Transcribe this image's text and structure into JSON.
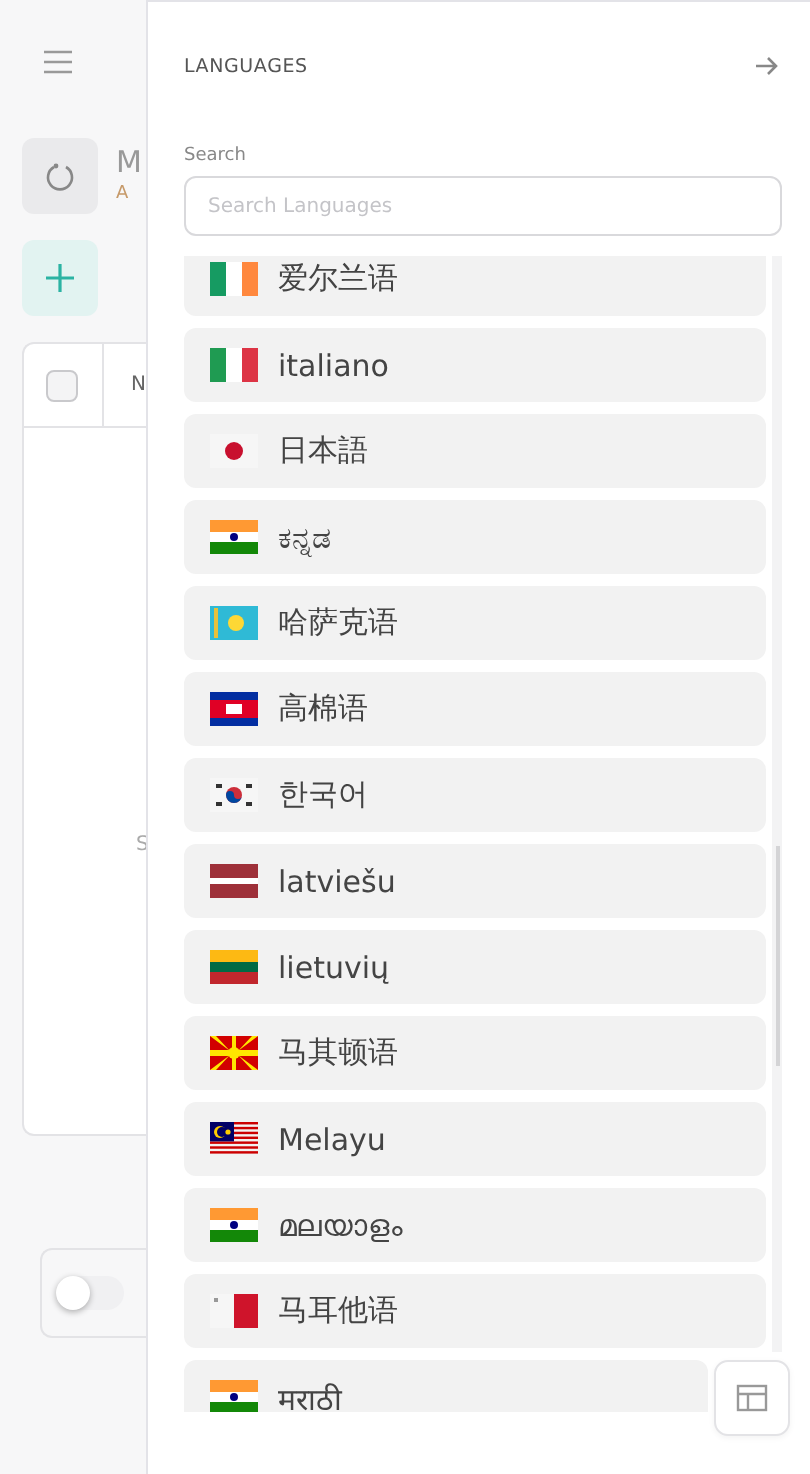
{
  "background": {
    "profile_initial": "M",
    "profile_sub": "A",
    "select_all": {
      "checked": false
    },
    "table_header": "N",
    "table_text": "S",
    "toggle": {
      "on": false
    }
  },
  "drawer": {
    "title": "LANGUAGES",
    "search_label": "Search",
    "search": {
      "placeholder": "Search Languages"
    },
    "languages": [
      {
        "name": "爱尔兰语",
        "kind": "ie"
      },
      {
        "name": "italiano",
        "kind": "it"
      },
      {
        "name": "日本語",
        "kind": "jp"
      },
      {
        "name": "ಕನ್ನಡ",
        "kind": "in"
      },
      {
        "name": "哈萨克语",
        "kind": "kz"
      },
      {
        "name": "高棉语",
        "kind": "kh"
      },
      {
        "name": "한국어",
        "kind": "kr"
      },
      {
        "name": "latviešu",
        "kind": "lv"
      },
      {
        "name": "lietuvių",
        "kind": "lt"
      },
      {
        "name": "马其顿语",
        "kind": "mk"
      },
      {
        "name": "Melayu",
        "kind": "my"
      },
      {
        "name": "മലയാളം",
        "kind": "in"
      },
      {
        "name": "马耳他语",
        "kind": "mt"
      },
      {
        "name": "मराठी",
        "kind": "in"
      }
    ]
  }
}
